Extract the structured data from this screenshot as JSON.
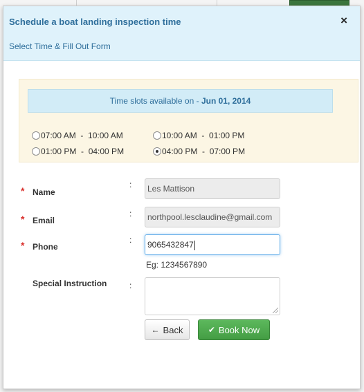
{
  "modal": {
    "title": "Schedule a boat landing inspection time",
    "subtitle": "Select Time & Fill Out Form",
    "close_symbol": "×"
  },
  "slots": {
    "banner_prefix": "Time slots available on - ",
    "banner_date": "Jun 01, 2014",
    "options": [
      {
        "label": "07:00 AM  -  10:00 AM",
        "selected": false
      },
      {
        "label": "10:00 AM  -  01:00 PM",
        "selected": false
      },
      {
        "label": "01:00 PM  -  04:00 PM",
        "selected": false
      },
      {
        "label": "04:00 PM  -  07:00 PM",
        "selected": true
      }
    ]
  },
  "form": {
    "required_mark": "*",
    "separator": ":",
    "name_label": "Name",
    "name_value": "Les Mattison",
    "email_label": "Email",
    "email_value": "northpool.lesclaudine@gmail.com",
    "phone_label": "Phone",
    "phone_value": "9065432847",
    "phone_hint": "Eg: 1234567890",
    "instruction_label": "Special Instruction",
    "instruction_value": ""
  },
  "buttons": {
    "back_label": "Back",
    "back_icon": "←",
    "book_label": "Book Now",
    "book_icon": "✔"
  },
  "colors": {
    "header_bg": "#dff2fb",
    "title_color": "#2e6e9b",
    "panel_bg": "#fcf6e4",
    "required": "#d9302c",
    "book_button": "#5cb85c"
  }
}
